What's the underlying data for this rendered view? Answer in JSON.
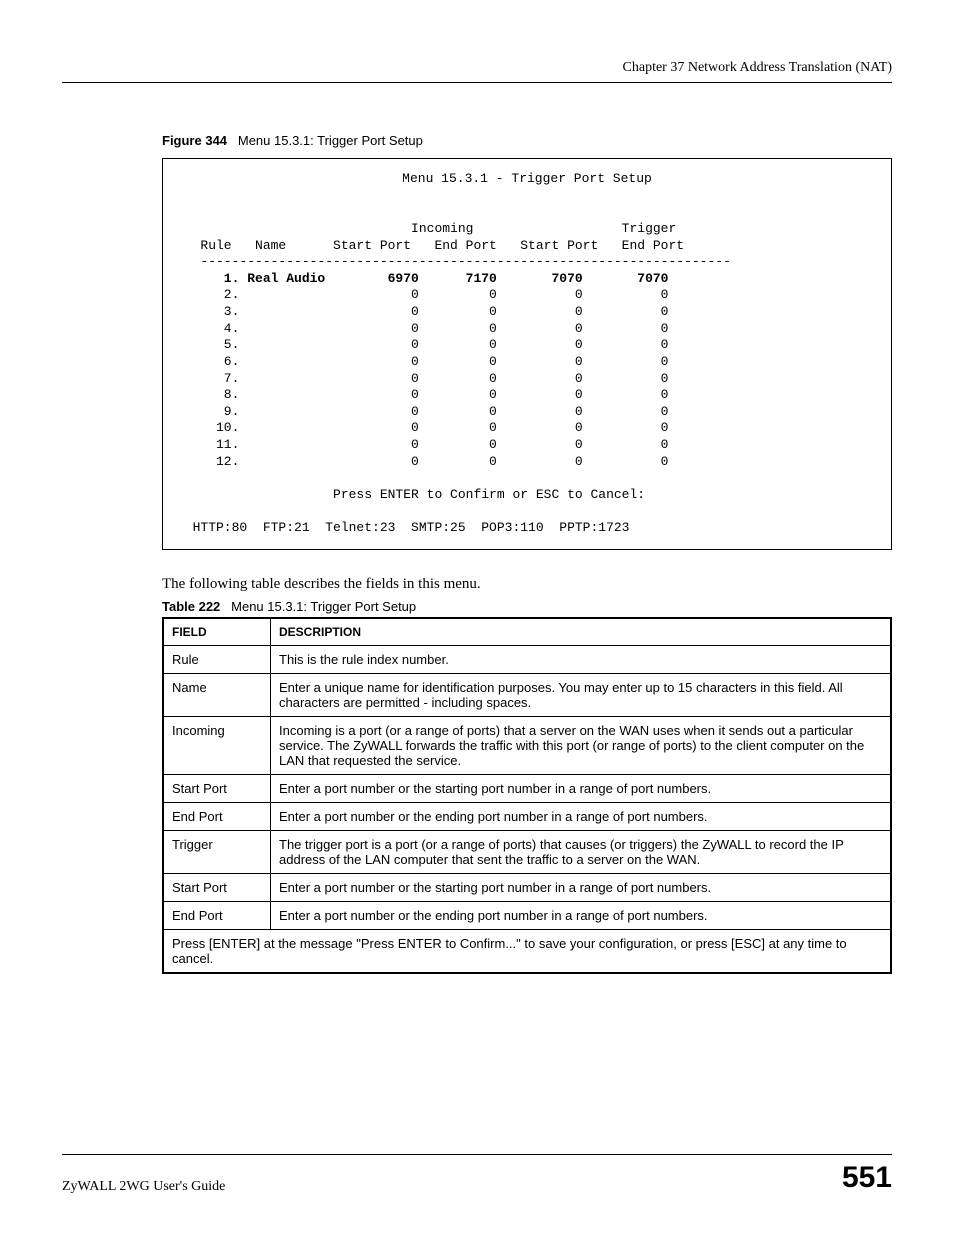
{
  "chapter_line": "Chapter 37 Network Address Translation (NAT)",
  "figure": {
    "label": "Figure 344",
    "caption": "Menu 15.3.1: Trigger Port Setup"
  },
  "menu": {
    "title": "Menu 15.3.1 - Trigger Port Setup",
    "header_group1": "Incoming",
    "header_group2": "Trigger",
    "col_rule": "Rule",
    "col_name": "Name",
    "col_sp": "Start Port",
    "col_ep": "End Port",
    "divider": "--------------------------------------------------------------------",
    "rows": [
      {
        "num": "1.",
        "name": "Real Audio",
        "isp": "6970",
        "iep": "7170",
        "tsp": "7070",
        "tep": "7070",
        "bold": true
      },
      {
        "num": "2.",
        "name": "",
        "isp": "0",
        "iep": "0",
        "tsp": "0",
        "tep": "0",
        "bold": false
      },
      {
        "num": "3.",
        "name": "",
        "isp": "0",
        "iep": "0",
        "tsp": "0",
        "tep": "0",
        "bold": false
      },
      {
        "num": "4.",
        "name": "",
        "isp": "0",
        "iep": "0",
        "tsp": "0",
        "tep": "0",
        "bold": false
      },
      {
        "num": "5.",
        "name": "",
        "isp": "0",
        "iep": "0",
        "tsp": "0",
        "tep": "0",
        "bold": false
      },
      {
        "num": "6.",
        "name": "",
        "isp": "0",
        "iep": "0",
        "tsp": "0",
        "tep": "0",
        "bold": false
      },
      {
        "num": "7.",
        "name": "",
        "isp": "0",
        "iep": "0",
        "tsp": "0",
        "tep": "0",
        "bold": false
      },
      {
        "num": "8.",
        "name": "",
        "isp": "0",
        "iep": "0",
        "tsp": "0",
        "tep": "0",
        "bold": false
      },
      {
        "num": "9.",
        "name": "",
        "isp": "0",
        "iep": "0",
        "tsp": "0",
        "tep": "0",
        "bold": false
      },
      {
        "num": "10.",
        "name": "",
        "isp": "0",
        "iep": "0",
        "tsp": "0",
        "tep": "0",
        "bold": false
      },
      {
        "num": "11.",
        "name": "",
        "isp": "0",
        "iep": "0",
        "tsp": "0",
        "tep": "0",
        "bold": false
      },
      {
        "num": "12.",
        "name": "",
        "isp": "0",
        "iep": "0",
        "tsp": "0",
        "tep": "0",
        "bold": false
      }
    ],
    "confirm": "Press ENTER to Confirm or ESC to Cancel:",
    "footer": "HTTP:80  FTP:21  Telnet:23  SMTP:25  POP3:110  PPTP:1723"
  },
  "description_intro": "The following table describes the fields in this menu.",
  "table": {
    "label": "Table 222",
    "caption": "Menu 15.3.1: Trigger Port Setup",
    "head_field": "FIELD",
    "head_desc": "DESCRIPTION",
    "rows": [
      {
        "field": "Rule",
        "desc": "This is the rule index number."
      },
      {
        "field": "Name",
        "desc": "Enter a unique name for identification purposes. You may enter up to 15 characters in this field. All characters are permitted - including spaces."
      },
      {
        "field": "Incoming",
        "desc": "Incoming is a port (or a range of ports) that a server on the WAN uses when it sends out a particular service. The ZyWALL forwards the traffic with this port (or range of ports) to the client computer on the LAN that requested the service."
      },
      {
        "field": "Start Port",
        "desc": "Enter a port number or the starting port number in a range of port numbers."
      },
      {
        "field": "End Port",
        "desc": "Enter a port number or the ending port number in a range of port numbers."
      },
      {
        "field": "Trigger",
        "desc": "The trigger port is a port (or a range of ports) that causes (or triggers) the ZyWALL to record the IP address of the LAN computer that sent the traffic to a server on the WAN."
      },
      {
        "field": "Start Port",
        "desc": "Enter a port number or the starting port number in a range of port numbers."
      },
      {
        "field": "End Port",
        "desc": "Enter a port number or the ending port number in a range of port numbers."
      }
    ],
    "last_row": "Press [ENTER] at the message \"Press ENTER to Confirm...\" to save your configuration, or press [ESC] at any time to cancel."
  },
  "footer_left": "ZyWALL 2WG User's Guide",
  "footer_right": "551"
}
